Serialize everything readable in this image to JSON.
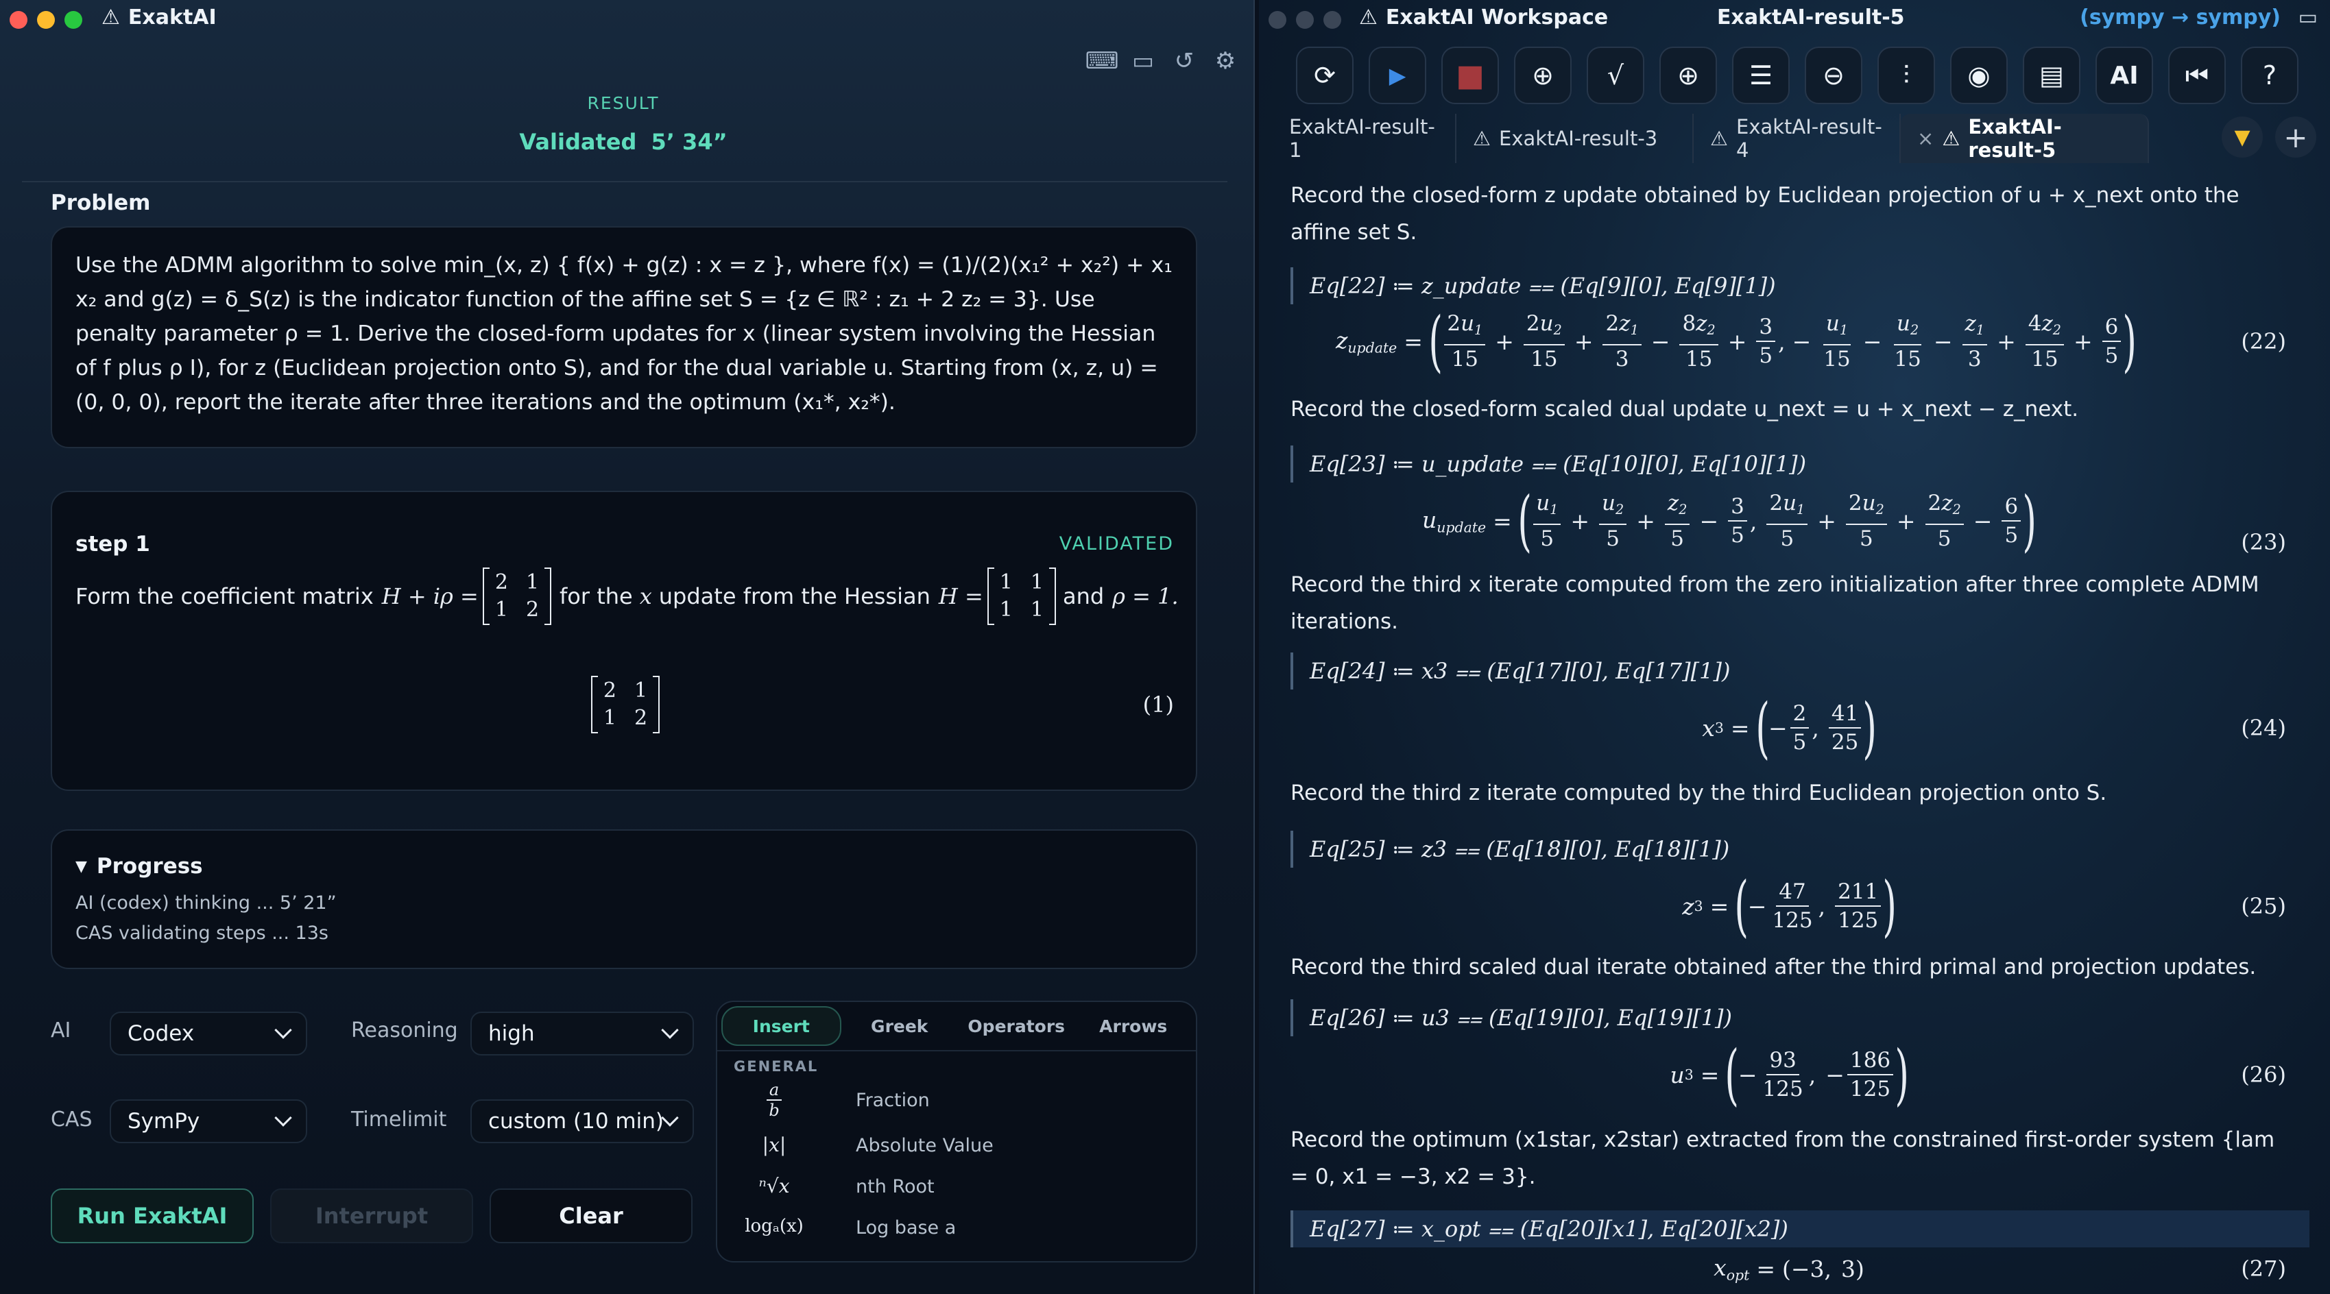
{
  "left_window": {
    "app_title": "ExaktAI",
    "traffic_colors": [
      "#ff5f57",
      "#febc2e",
      "#28c840"
    ],
    "toolbar_icons": [
      "keyboard-icon",
      "presentation-icon",
      "history-icon",
      "settings-icon"
    ],
    "result_label": "RESULT",
    "validated_label": "Validated",
    "validated_time": "5’ 34”",
    "problem_heading": "Problem",
    "problem_text": "Use the ADMM algorithm to solve min_(x, z) { f(x) + g(z) : x = z }, where f(x) = (1)/(2)(x₁² + x₂²) + x₁ x₂ and g(z) = δ_S(z) is the indicator function of the affine set S = {z ∈ ℝ² : z₁ + 2 z₂ = 3}. Use penalty parameter ρ = 1. Derive the closed-form updates for x (linear system involving the Hessian of f plus ρ I), for z (Euclidean projection onto S), and for the dual variable u. Starting from (x, z, u) = (0, 0, 0), report the iterate after three iterations and the optimum (x₁*, x₂*).",
    "step": {
      "title": "step 1",
      "status": "VALIDATED",
      "text_a": "Form the coefficient matrix",
      "text_b": "for the",
      "text_c": "update from the Hessian",
      "text_d": "and",
      "math_lhs": "H + iρ =",
      "math_x": "x",
      "math_h": "H =",
      "math_rho": "ρ = 1.",
      "matrix_a": [
        "2",
        "1",
        "1",
        "2"
      ],
      "matrix_h": [
        "1",
        "1",
        "1",
        "1"
      ],
      "display_matrix": [
        "2",
        "1",
        "1",
        "2"
      ],
      "eq_number": "(1)"
    },
    "progress": {
      "heading": "Progress",
      "lines": [
        "AI (codex) thinking ... 5’ 21”",
        "CAS validating steps ... 13s"
      ]
    },
    "controls": {
      "ai_label": "AI",
      "ai_value": "Codex",
      "reasoning_label": "Reasoning",
      "reasoning_value": "high",
      "cas_label": "CAS",
      "cas_value": "SymPy",
      "timelimit_label": "Timelimit",
      "timelimit_value": "custom (10 min)",
      "run_label": "Run ExaktAI",
      "interrupt_label": "Interrupt",
      "clear_label": "Clear"
    },
    "insert_panel": {
      "tabs": [
        "Insert",
        "Greek",
        "Operators",
        "Arrows"
      ],
      "active_tab": "Insert",
      "section": "GENERAL",
      "items": [
        {
          "symbol_num": "a",
          "symbol_den": "b",
          "name": "Fraction"
        },
        {
          "symbol": "|x|",
          "name": "Absolute Value"
        },
        {
          "symbol": "ⁿ√x",
          "name": "nth Root"
        },
        {
          "symbol": "logₐ(x)",
          "name": "Log base a"
        }
      ]
    }
  },
  "right_window": {
    "app_title": "ExaktAI Workspace",
    "doc_title": "ExaktAI-result-5",
    "backend": "(sympy → sympy)",
    "toolbar_icons": [
      "refresh-icon",
      "play-icon",
      "stop-icon",
      "zoom-step-icon",
      "sqrt-icon",
      "insert-cell-icon",
      "align-icon",
      "minus-circle-icon",
      "indent-icon",
      "eye-icon",
      "split-icon",
      "ai-icon",
      "skip-back-icon",
      "help-icon"
    ],
    "toolbar_glyphs": [
      "⟳",
      "▶",
      "■",
      "⊕",
      "√",
      "⊕",
      "☰",
      "⊖",
      "⫶",
      "◉",
      "▤",
      "AI",
      "⏮",
      "?"
    ],
    "ai_text": "AI",
    "tabs": [
      "ExaktAI-result-1",
      "ExaktAI-result-3",
      "ExaktAI-result-4",
      "ExaktAI-result-5"
    ],
    "active_tab": "ExaktAI-result-5",
    "tab_plus": "+",
    "tab_dropdown": "▼",
    "cells": [
      {
        "para": "Record the closed-form z update obtained by Euclidean projection of u + x_next onto the affine set S.",
        "code": "Eq[22] ≔ z_update ⩵ (Eq[9][0], Eq[9][1])",
        "num": "(22)"
      },
      {
        "para": "Record the closed-form scaled dual update u_next = u + x_next − z_next.",
        "code": "Eq[23] ≔ u_update ⩵ (Eq[10][0], Eq[10][1])",
        "num": "(23)"
      },
      {
        "para": "Record the third x iterate computed from the zero initialization after three complete ADMM iterations.",
        "code": "Eq[24] ≔ x3 ⩵ (Eq[17][0], Eq[17][1])",
        "num": "(24)"
      },
      {
        "para": "Record the third z iterate computed by the third Euclidean projection onto S.",
        "code": "Eq[25] ≔ z3 ⩵ (Eq[18][0], Eq[18][1])",
        "num": "(25)"
      },
      {
        "para": "Record the third scaled dual iterate obtained after the third primal and projection updates.",
        "code": "Eq[26] ≔ u3 ⩵ (Eq[19][0], Eq[19][1])",
        "num": "(26)"
      },
      {
        "para": "Record the optimum (x1star, x2star) extracted from the constrained first-order system {lam = 0, x1 = −3, x2 = 3}.",
        "code": "Eq[27] ≔ x_opt ⩵ (Eq[20][x1], Eq[20][x2])",
        "num": "(27)"
      }
    ],
    "results": {
      "x3": [
        "−2/5",
        "41/25"
      ],
      "z3": [
        "−47/125",
        "211/125"
      ],
      "u3": [
        "−93/125",
        "−186/125"
      ],
      "x_opt": [
        "−3",
        "3"
      ]
    }
  }
}
